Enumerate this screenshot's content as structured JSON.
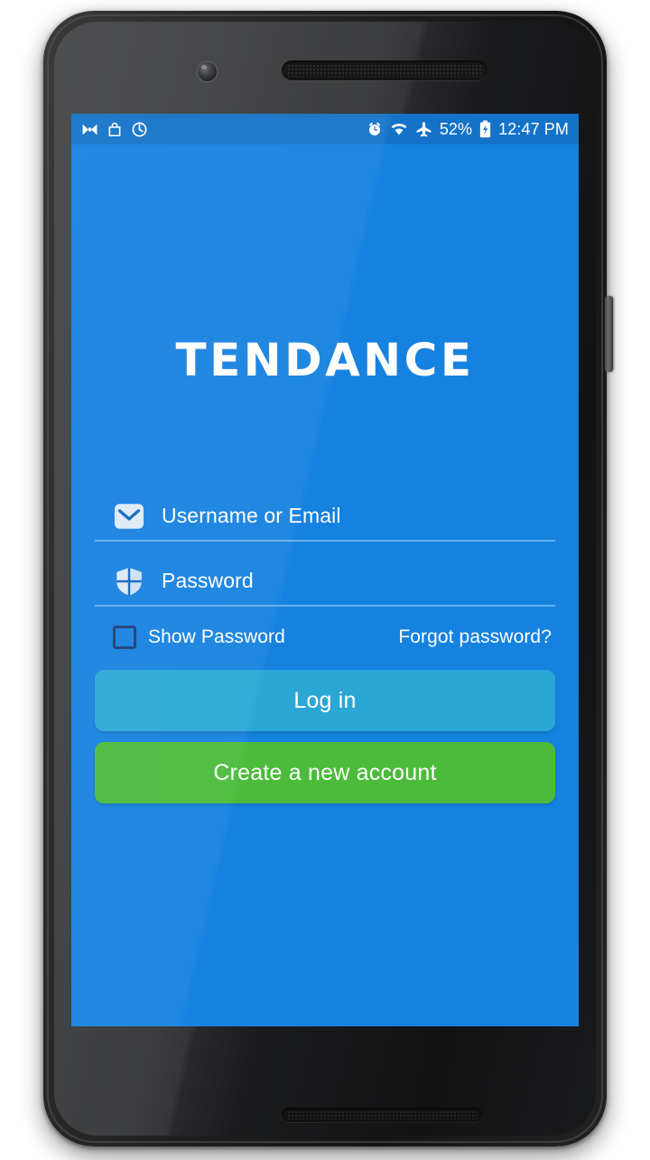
{
  "status_bar": {
    "left_icons": [
      "bowtie-icon",
      "shopping-bag-icon",
      "timer-icon"
    ],
    "right_icons": [
      "alarm-clock-icon",
      "wifi-icon",
      "airplane-mode-icon",
      "battery-charging-icon"
    ],
    "battery_percent": "52%",
    "time": "12:47 PM",
    "background_color": "#1473c8"
  },
  "app": {
    "logo_text": "TENDANCE",
    "background_color": "#1682e0"
  },
  "form": {
    "username_field": {
      "icon": "envelope-icon",
      "value": "",
      "placeholder": "Username or Email"
    },
    "password_field": {
      "icon": "shield-icon",
      "value": "",
      "placeholder": "Password"
    },
    "show_password": {
      "label": "Show Password",
      "checked": false
    },
    "forgot_link": "Forgot password?"
  },
  "buttons": {
    "login": {
      "label": "Log in",
      "color": "#2ba7d6"
    },
    "signup": {
      "label": "Create a new account",
      "color": "#4cbb3c"
    }
  }
}
